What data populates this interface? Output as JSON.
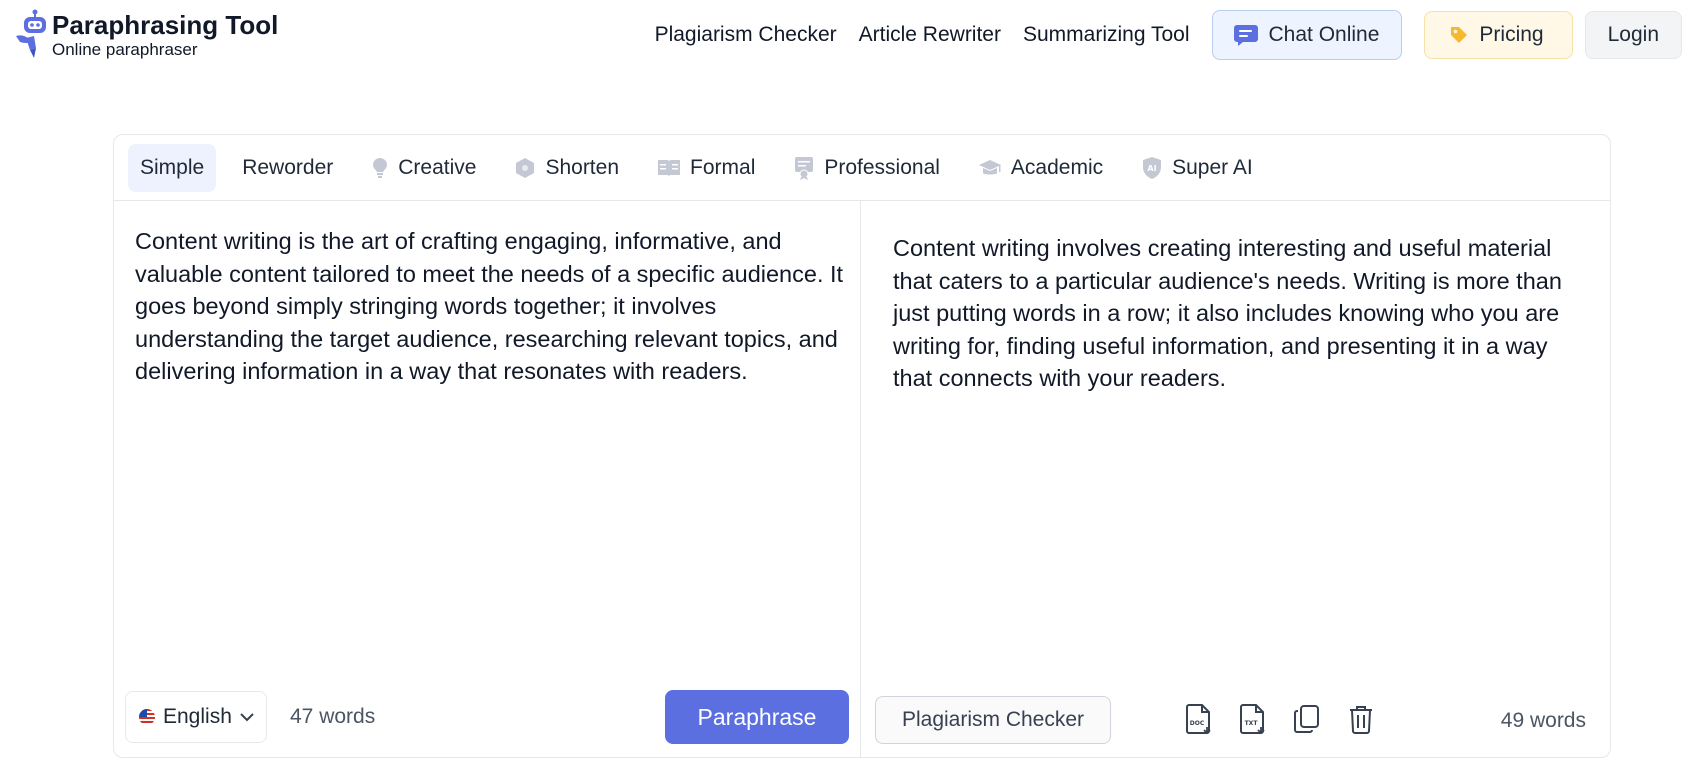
{
  "header": {
    "logo_title": "Paraphrasing Tool",
    "logo_subtitle": "Online paraphraser",
    "nav_links": [
      "Plagiarism Checker",
      "Article Rewriter",
      "Summarizing Tool"
    ],
    "chat_label": "Chat Online",
    "pricing_label": "Pricing",
    "login_label": "Login"
  },
  "tabs": [
    {
      "label": "Simple",
      "icon": "none",
      "active": true
    },
    {
      "label": "Reworder",
      "icon": "none",
      "active": false
    },
    {
      "label": "Creative",
      "icon": "lightbulb-icon",
      "active": false
    },
    {
      "label": "Shorten",
      "icon": "hexagon-icon",
      "active": false
    },
    {
      "label": "Formal",
      "icon": "book-icon",
      "active": false
    },
    {
      "label": "Professional",
      "icon": "certificate-icon",
      "active": false
    },
    {
      "label": "Academic",
      "icon": "graduation-cap-icon",
      "active": false
    },
    {
      "label": "Super AI",
      "icon": "ai-shield-icon",
      "active": false
    }
  ],
  "input": {
    "text": "Content writing is the art of crafting engaging, informative, and valuable content tailored to meet the needs of a specific audience. It goes beyond simply stringing words together; it involves understanding the target audience, researching relevant topics, and delivering information in a way that resonates with readers.",
    "language": "English",
    "word_count": "47 words",
    "paraphrase_label": "Paraphrase"
  },
  "output": {
    "text": "Content writing involves creating interesting and useful material that caters to a particular audience's needs. Writing is more than just putting words in a row; it also includes knowing who you are writing for, finding useful information, and presenting it in a way that connects with your readers.",
    "plagiarism_label": "Plagiarism Checker",
    "word_count": "49 words",
    "tools": [
      "doc-download-icon",
      "txt-download-icon",
      "copy-icon",
      "trash-icon"
    ]
  },
  "colors": {
    "accent": "#5b6fe0",
    "chat_bg": "#eef4ff",
    "pricing_bg": "#fff8e6",
    "tab_active_bg": "#eef2ff",
    "icon_gray": "#c3c8d4"
  }
}
